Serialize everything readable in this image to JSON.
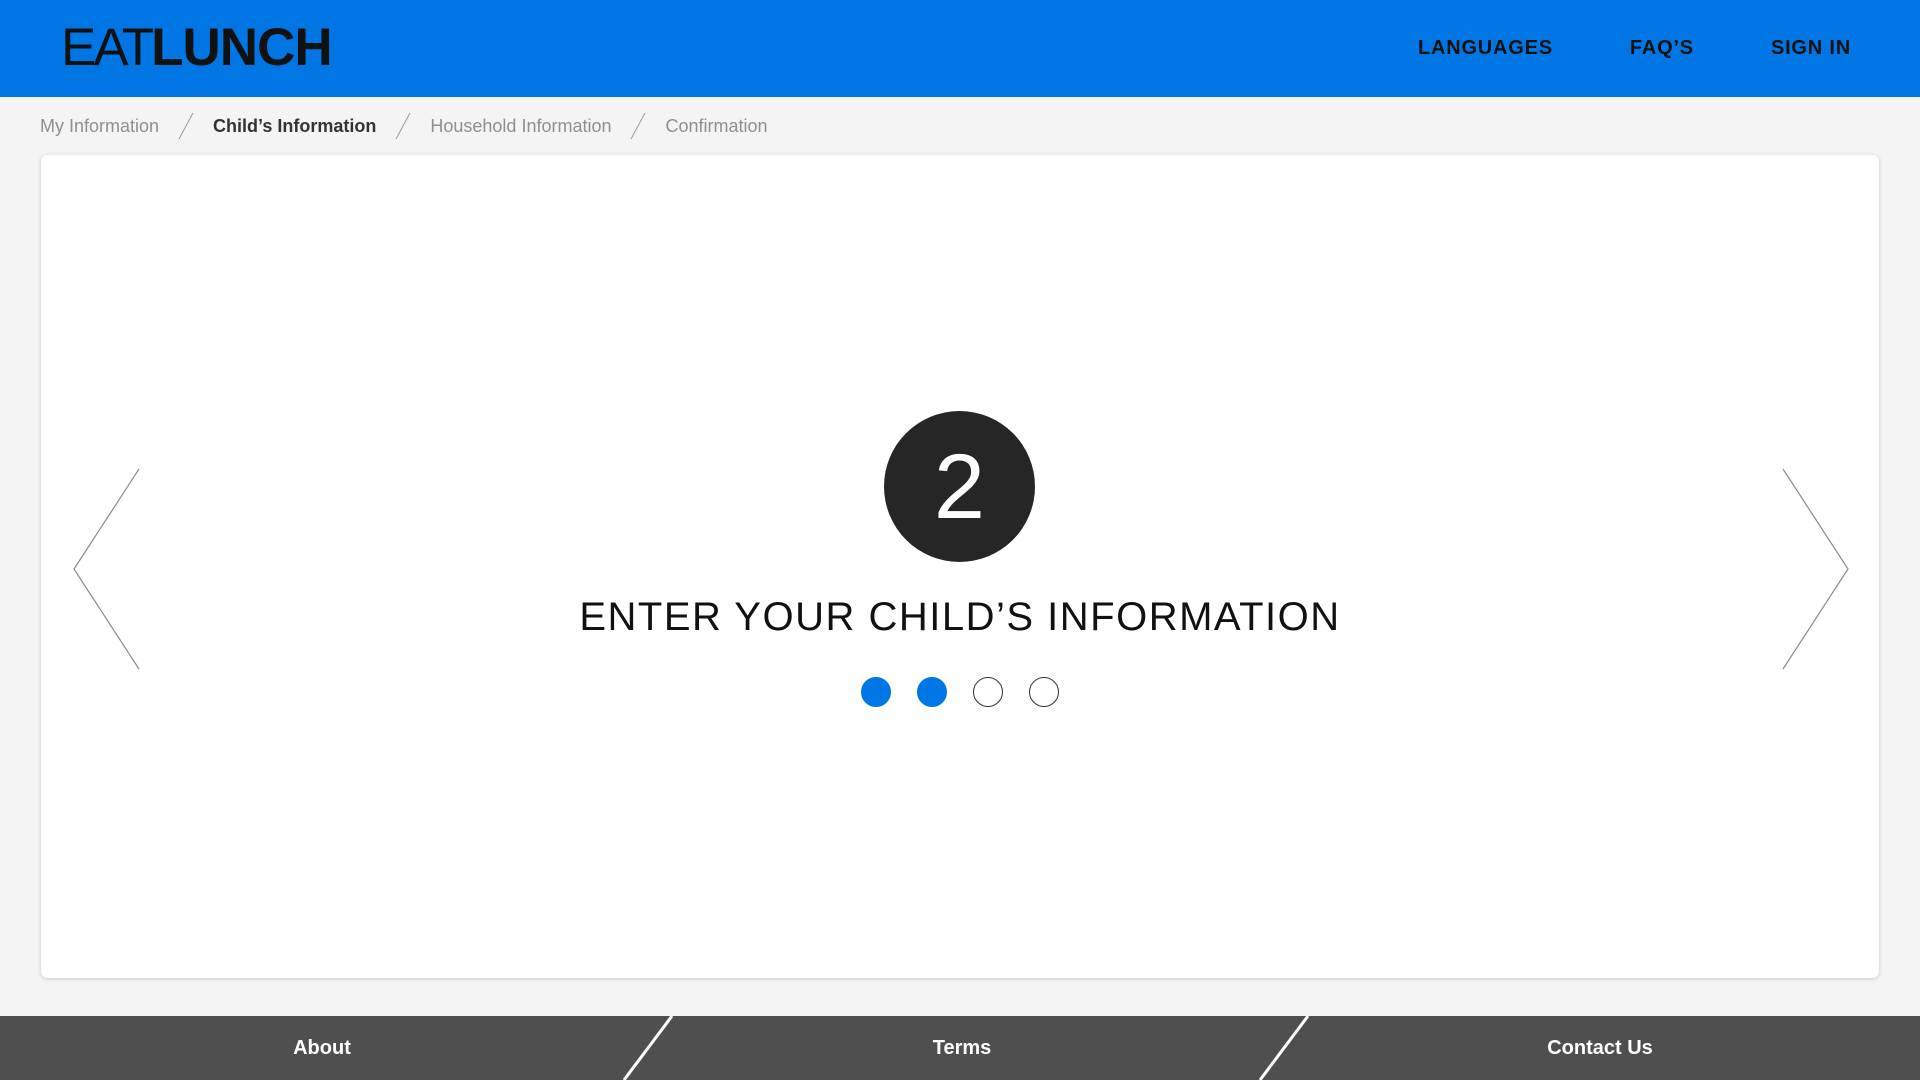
{
  "header": {
    "logo_thin": "EAT",
    "logo_bold": "LUNCH",
    "nav": [
      {
        "label": "LANGUAGES"
      },
      {
        "label": "FAQ’S"
      },
      {
        "label": "SIGN IN"
      }
    ]
  },
  "breadcrumb": [
    {
      "label": "My Information",
      "active": false
    },
    {
      "label": "Child’s Information",
      "active": true
    },
    {
      "label": "Household Information",
      "active": false
    },
    {
      "label": "Confirmation",
      "active": false
    }
  ],
  "step": {
    "number": "2",
    "title": "ENTER YOUR CHILD’S INFORMATION",
    "total_steps": 4,
    "completed_steps": 2
  },
  "footer": {
    "about": "About",
    "terms": "Terms",
    "contact": "Contact Us"
  },
  "colors": {
    "brand_blue": "#0076e4",
    "dark": "#262626",
    "footer_bg": "#4f4f4f"
  },
  "icons": {
    "prev": "chevron-left-icon",
    "next": "chevron-right-icon"
  }
}
